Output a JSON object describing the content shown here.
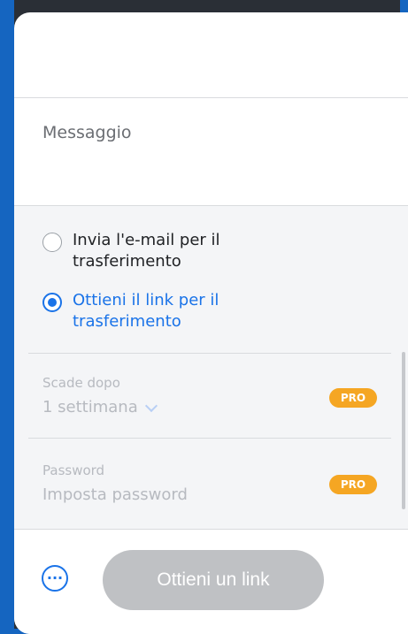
{
  "message": {
    "placeholder": "Messaggio"
  },
  "transfer_mode": {
    "options": [
      {
        "label": "Invia l'e-mail per il trasferimento",
        "selected": false
      },
      {
        "label": "Ottieni il link per il trasferimento",
        "selected": true
      }
    ]
  },
  "expiry": {
    "label": "Scade dopo",
    "value": "1 settimana",
    "badge": "PRO"
  },
  "password": {
    "label": "Password",
    "placeholder": "Imposta password",
    "badge": "PRO"
  },
  "actions": {
    "more_glyph": "···",
    "primary_label": "Ottieni un link"
  },
  "colors": {
    "accent": "#1a73e8",
    "pro_badge": "#f5a623",
    "disabled_button": "#bfc1c4"
  },
  "icons": {
    "more": "more-options-icon",
    "chevron": "chevron-down-icon"
  }
}
